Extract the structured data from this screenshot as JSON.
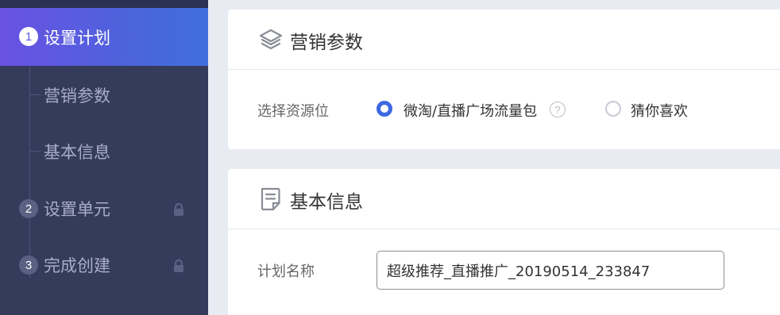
{
  "sidebar": {
    "steps": [
      {
        "number": "1",
        "label": "设置计划",
        "active": true
      },
      {
        "number": "2",
        "label": "设置单元",
        "locked": true
      },
      {
        "number": "3",
        "label": "完成创建",
        "locked": true
      }
    ],
    "substeps": [
      {
        "label": "营销参数"
      },
      {
        "label": "基本信息"
      }
    ]
  },
  "marketing": {
    "title": "营销参数",
    "icon": "layers-icon",
    "field_label": "选择资源位",
    "options": [
      {
        "label": "微淘/直播广场流量包",
        "selected": true,
        "help": "?"
      },
      {
        "label": "猜你喜欢",
        "selected": false
      }
    ]
  },
  "basic": {
    "title": "基本信息",
    "icon": "document-icon",
    "plan_name_label": "计划名称",
    "plan_name_value": "超级推荐_直播推广_20190514_233847"
  },
  "colors": {
    "accent": "#3d68e0",
    "sidebar_bg": "#343b5b",
    "active_gradient_start": "#6a51e3",
    "active_gradient_end": "#3f6ede"
  }
}
